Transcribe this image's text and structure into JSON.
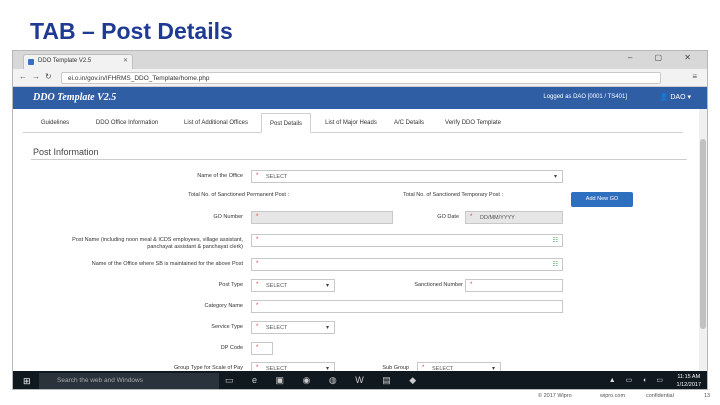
{
  "slide": {
    "title": "TAB – Post Details"
  },
  "browser": {
    "tab_title": "DDO Template V2.5",
    "url": "ei.o.in/gov.in/IFHRMS_DDO_Template/home.php"
  },
  "app": {
    "brand": "DDO Template V2.5",
    "login_info": "Logged as DAO [0001 / TS401]",
    "user_menu": "DAO"
  },
  "tabs": [
    {
      "label": "Guidelines"
    },
    {
      "label": "DDO Office Information"
    },
    {
      "label": "List of Additional Offices"
    },
    {
      "label": "Post Details"
    },
    {
      "label": "List of Major Heads"
    },
    {
      "label": "A/C Details"
    },
    {
      "label": "Verify DDO Template"
    }
  ],
  "form": {
    "section_title": "Post Information",
    "name_of_office": {
      "label": "Name of the Office",
      "value": "SELECT"
    },
    "sanctioned_permanent": {
      "label": "Total No. of Sanctioned Permanent Post :"
    },
    "sanctioned_temporary": {
      "label": "Total No. of Sanctioned Temporary Post :"
    },
    "add_button": "Add New GO",
    "go_number": {
      "label": "GO Number"
    },
    "go_date": {
      "label": "GO Date",
      "placeholder": "DD/MM/YYYY"
    },
    "post_name": {
      "label": "Post Name (including noon meal & ICDS employees, village assistant, panchayat assistant & panchayat clerk)"
    },
    "office_sb": {
      "label": "Name of the Office where SB is maintained for the above Post"
    },
    "post_type": {
      "label": "Post Type",
      "value": "SELECT"
    },
    "sanctioned_number": {
      "label": "Sanctioned Number"
    },
    "category_name": {
      "label": "Category Name"
    },
    "service_type": {
      "label": "Service Type",
      "value": "SELECT"
    },
    "dp_code": {
      "label": "DP Code"
    },
    "group_type": {
      "label": "Group Type for Scale of Pay",
      "value": "SELECT"
    },
    "sub_group": {
      "label": "Sub Group",
      "value": "SELECT"
    }
  },
  "taskbar": {
    "search_placeholder": "Search the web and Windows",
    "time": "11:15 AM",
    "date": "1/12/2017"
  },
  "footer": {
    "copyright": "© 2017 Wipro",
    "site": "wipro.com",
    "confidential": "confidential",
    "page_number": "13"
  }
}
